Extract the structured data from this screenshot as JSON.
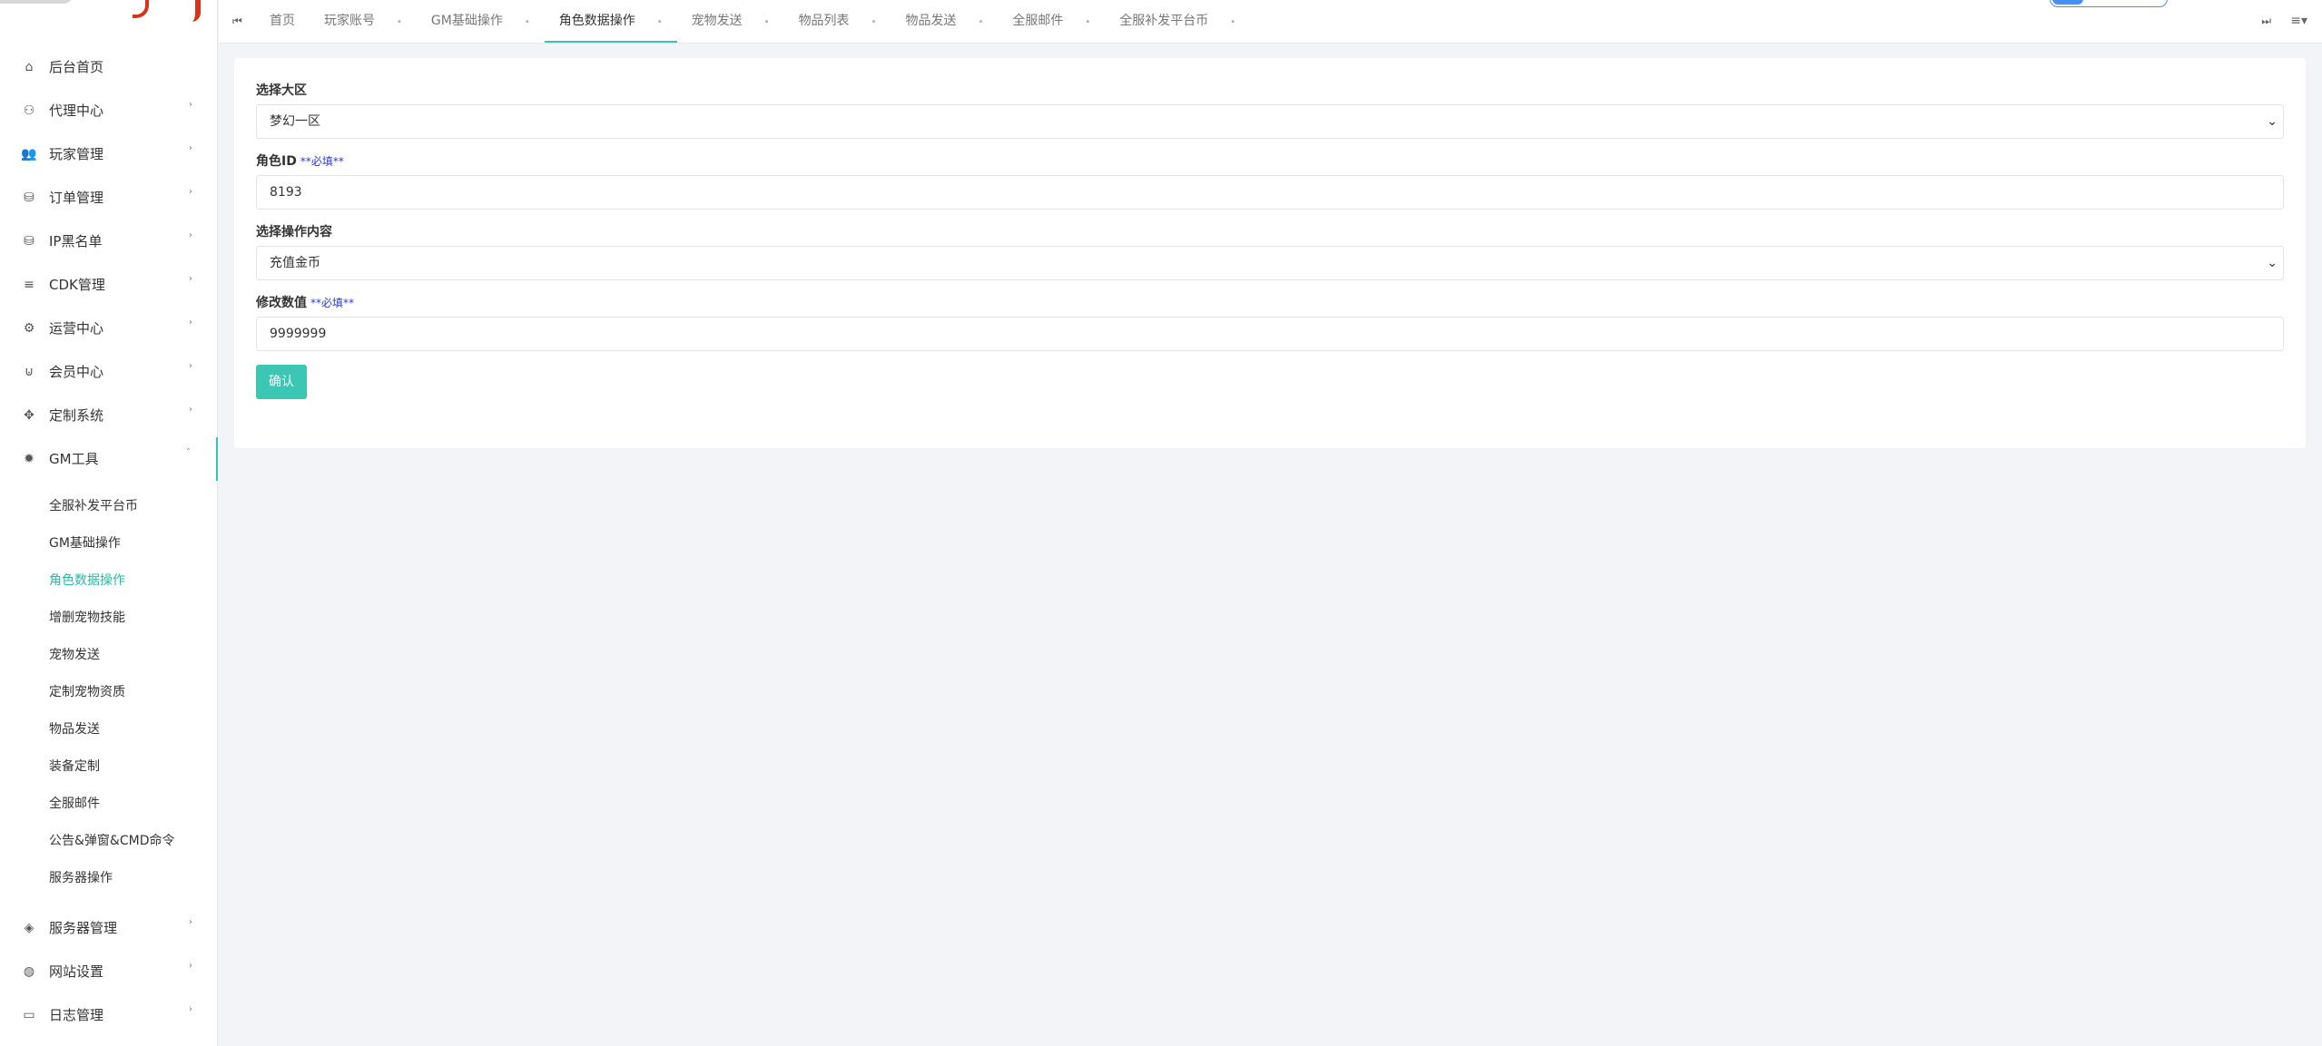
{
  "sidebar": {
    "items": [
      {
        "label": "后台首页",
        "icon": "home-icon",
        "glyph": "⌂",
        "has_children": false
      },
      {
        "label": "代理中心",
        "icon": "users-outline-icon",
        "glyph": "⚇",
        "has_children": true
      },
      {
        "label": "玩家管理",
        "icon": "users-icon",
        "glyph": "👥",
        "has_children": true
      },
      {
        "label": "订单管理",
        "icon": "database-icon",
        "glyph": "⛁",
        "has_children": true
      },
      {
        "label": "IP黑名单",
        "icon": "database-plus-icon",
        "glyph": "⛁",
        "has_children": true
      },
      {
        "label": "CDK管理",
        "icon": "sort-list-icon",
        "glyph": "≡",
        "has_children": true
      },
      {
        "label": "运营中心",
        "icon": "gear-icon",
        "glyph": "⚙",
        "has_children": true
      },
      {
        "label": "会员中心",
        "icon": "magnet-icon",
        "glyph": "⊍",
        "has_children": true
      },
      {
        "label": "定制系统",
        "icon": "gamepad-icon",
        "glyph": "✥",
        "has_children": true
      },
      {
        "label": "GM工具",
        "icon": "bug-icon",
        "glyph": "✹",
        "has_children": true,
        "open": true
      }
    ],
    "gm_sub_items": [
      {
        "label": "全服补发平台币",
        "active": false
      },
      {
        "label": "GM基础操作",
        "active": false
      },
      {
        "label": "角色数据操作",
        "active": true
      },
      {
        "label": "增删宠物技能",
        "active": false
      },
      {
        "label": "宠物发送",
        "active": false
      },
      {
        "label": "定制宠物资质",
        "active": false
      },
      {
        "label": "物品发送",
        "active": false
      },
      {
        "label": "装备定制",
        "active": false
      },
      {
        "label": "全服邮件",
        "active": false
      },
      {
        "label": "公告&弹窗&CMD命令",
        "active": false
      },
      {
        "label": "服务器操作",
        "active": false
      }
    ],
    "bottom_items": [
      {
        "label": "服务器管理",
        "icon": "diamond-icon",
        "glyph": "◈",
        "has_children": true
      },
      {
        "label": "网站设置",
        "icon": "globe-icon",
        "glyph": "◍",
        "has_children": true
      },
      {
        "label": "日志管理",
        "icon": "comment-icon",
        "glyph": "▭",
        "has_children": true
      }
    ]
  },
  "tabs": {
    "first_icon": "⏮",
    "last_icon": "⏭",
    "menu_icon": "≡▾",
    "close_glyph": "•",
    "items": [
      {
        "label": "首页",
        "closable": false,
        "active": false
      },
      {
        "label": "玩家账号",
        "closable": true,
        "active": false
      },
      {
        "label": "GM基础操作",
        "closable": true,
        "active": false
      },
      {
        "label": "角色数据操作",
        "closable": true,
        "active": true
      },
      {
        "label": "宠物发送",
        "closable": true,
        "active": false
      },
      {
        "label": "物品列表",
        "closable": true,
        "active": false
      },
      {
        "label": "物品发送",
        "closable": true,
        "active": false
      },
      {
        "label": "全服邮件",
        "closable": true,
        "active": false
      },
      {
        "label": "全服补发平台币",
        "closable": true,
        "active": false
      }
    ]
  },
  "form": {
    "region_label": "选择大区",
    "region_value": "梦幻一区",
    "role_id_label": "角色ID",
    "required_hint": "**必填**",
    "role_id_value": "8193",
    "operation_label": "选择操作内容",
    "operation_value": "充值金币",
    "amount_label": "修改数值",
    "amount_value": "9999999",
    "caret": "⌄",
    "confirm_label": "确认"
  },
  "colors": {
    "accent": "#38c4b0",
    "required": "#2a3cd0",
    "button": "#3cc6b4"
  }
}
